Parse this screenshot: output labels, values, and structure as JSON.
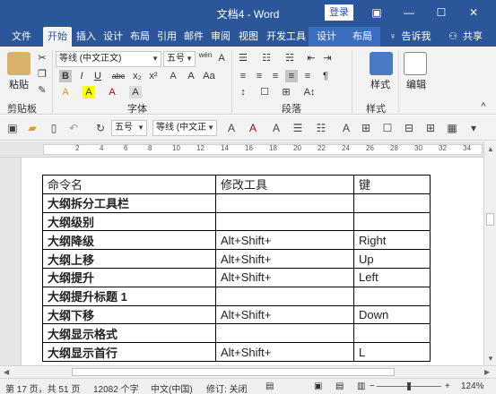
{
  "window": {
    "title": "文档4 - Word",
    "login_label": "登录",
    "controls": [
      "▣",
      "—",
      "☐",
      "✕"
    ]
  },
  "tabs": [
    "文件",
    "开始",
    "插入",
    "设计",
    "布局",
    "引用",
    "邮件",
    "审阅",
    "视图",
    "开发工具",
    "设计",
    "布局"
  ],
  "active_tab": "开始",
  "tell_me": "告诉我",
  "share": "共享",
  "ribbon": {
    "font_name": "等线 (中文正文)",
    "font_size": "五号",
    "wen_label": "wén",
    "paste_label": "粘贴",
    "styles_label": "样式",
    "edit_label": "编辑",
    "groups": {
      "clipboard": "剪贴板",
      "font": "字体",
      "paragraph": "段落",
      "styles": "样式"
    },
    "font_buttons": [
      "B",
      "I",
      "U",
      "abc",
      "x₂",
      "x²",
      "A",
      "A",
      "Aa",
      "A",
      "A",
      "A",
      "A"
    ],
    "para_buttons": [
      "≡",
      "≡",
      "≡",
      "≡",
      "≡",
      "¶",
      "↕",
      "☐",
      "⊞",
      "A↕"
    ]
  },
  "toolbar2": {
    "font_size": "五号",
    "font_name": "等线 (中文正"
  },
  "ruler": {
    "marks": [
      "2",
      "4",
      "6",
      "8",
      "10",
      "12",
      "14",
      "16",
      "18",
      "20",
      "22",
      "24",
      "26",
      "28",
      "30",
      "32",
      "34"
    ]
  },
  "table": {
    "headers": [
      "命令名",
      "修改工具",
      "键"
    ],
    "rows": [
      [
        "大纲拆分工具栏",
        "",
        ""
      ],
      [
        "大纲级别",
        "",
        ""
      ],
      [
        "大纲降级",
        "Alt+Shift+",
        "Right"
      ],
      [
        "大纲上移",
        "Alt+Shift+",
        "Up"
      ],
      [
        "大纲提升",
        "Alt+Shift+",
        "Left"
      ],
      [
        "大纲提升标题 1",
        "",
        ""
      ],
      [
        "大纲下移",
        "Alt+Shift+",
        "Down"
      ],
      [
        "大纲显示格式",
        "",
        ""
      ],
      [
        "大纲显示首行",
        "Alt+Shift+",
        "L"
      ]
    ]
  },
  "status": {
    "page": "第 17 页，共 51 页",
    "words": "12082 个字",
    "lang": "中文(中国)",
    "revision": "修订: 关闭",
    "zoom": "124%"
  }
}
